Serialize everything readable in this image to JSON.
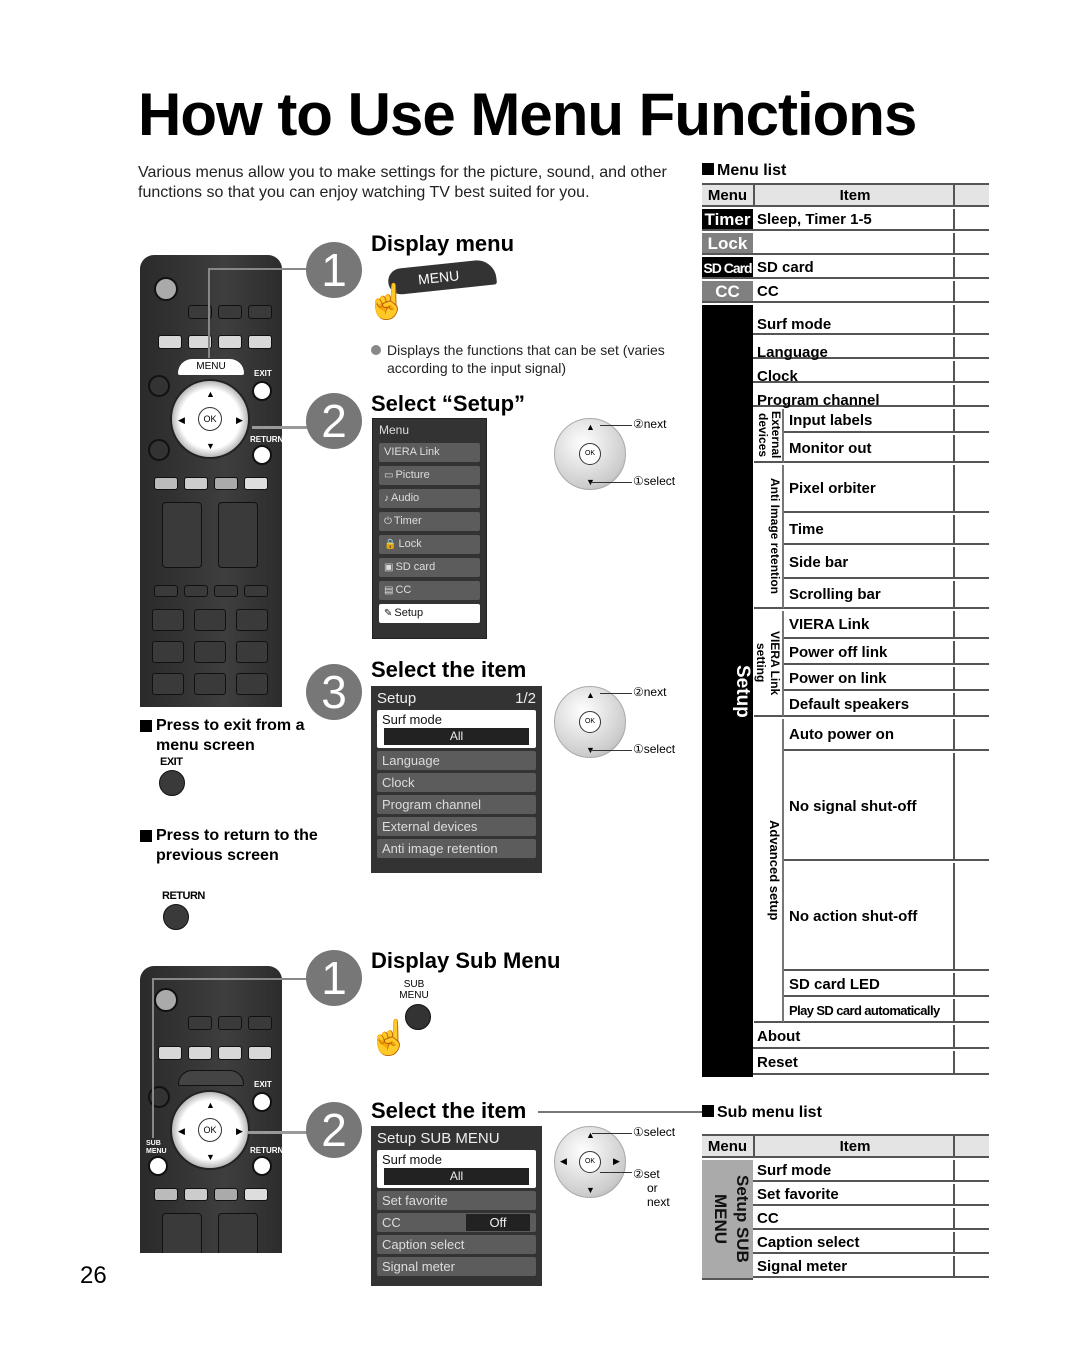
{
  "page": {
    "title": "How to Use Menu Functions",
    "intro": "Various menus allow you to make settings for the picture, sound, and other functions so that you can enjoy watching TV best suited for you.",
    "page_number": "26"
  },
  "remote": {
    "menu_label": "MENU",
    "exit_label": "EXIT",
    "return_label": "RETURN",
    "ok_label": "OK",
    "sub_menu_label": "SUB\nMENU"
  },
  "section1": {
    "steps": [
      {
        "number": "1",
        "heading": "Display menu",
        "button_label": "MENU",
        "note": "Displays the functions that can be set (varies according to the input signal)"
      },
      {
        "number": "2",
        "heading": "Select “Setup”"
      },
      {
        "number": "3",
        "heading": "Select the item"
      }
    ],
    "menu_osd": {
      "title": "Menu",
      "items": [
        {
          "icon": "",
          "label": "VIERA Link"
        },
        {
          "icon": "picture-icon",
          "label": "Picture"
        },
        {
          "icon": "audio-icon",
          "label": "Audio"
        },
        {
          "icon": "timer-icon",
          "label": "Timer"
        },
        {
          "icon": "lock-icon",
          "label": "Lock"
        },
        {
          "icon": "sd-card-icon",
          "label": "SD card"
        },
        {
          "icon": "cc-icon",
          "label": "CC"
        },
        {
          "icon": "setup-icon",
          "label": "Setup",
          "selected": true
        }
      ]
    },
    "setup_osd": {
      "title": "Setup",
      "page": "1/2",
      "selected_item": "Surf mode",
      "selected_value": "All",
      "items": [
        "Language",
        "Clock",
        "Program channel",
        "External devices",
        "Anti image retention"
      ]
    },
    "wheel_notes": {
      "next": "②next",
      "select": "①select"
    }
  },
  "side_notes": {
    "exit_heading": "Press to exit from a menu screen",
    "exit_button": "EXIT",
    "return_heading": "Press to return to the previous screen",
    "return_button": "RETURN"
  },
  "section2": {
    "steps": [
      {
        "number": "1",
        "heading": "Display Sub Menu",
        "button_label": "SUB MENU"
      },
      {
        "number": "2",
        "heading": "Select the item"
      }
    ],
    "sub_osd": {
      "title": "Setup SUB MENU",
      "selected_item": "Surf mode",
      "selected_value": "All",
      "items": [
        {
          "label": "Set favorite"
        },
        {
          "label": "CC",
          "value": "Off"
        },
        {
          "label": "Caption select"
        },
        {
          "label": "Signal meter"
        }
      ]
    },
    "wheel_notes": {
      "select": "①select",
      "set": "②set",
      "or": "or",
      "next": "next"
    }
  },
  "menu_list": {
    "heading": "Menu list",
    "col_menu": "Menu",
    "col_item": "Item",
    "top_rows": [
      {
        "menu": "Timer",
        "item": "Sleep, Timer 1-5",
        "color": "#000000"
      },
      {
        "menu": "Lock",
        "item": "",
        "color": "#808080"
      },
      {
        "menu": "SD Card",
        "item": "SD card",
        "color": "#000000"
      },
      {
        "menu": "CC",
        "item": "CC",
        "color": "#808080"
      }
    ],
    "setup_label": "Setup",
    "setup_items": [
      "Surf mode",
      "Language",
      "Clock",
      "Program channel"
    ],
    "groups": [
      {
        "label": "External devices",
        "items": [
          "Input labels",
          "Monitor out"
        ]
      },
      {
        "label": "Anti Image retention",
        "items": [
          "Pixel orbiter",
          "Time",
          "Side bar",
          "Scrolling bar"
        ]
      },
      {
        "label": "VIERA Link setting",
        "items": [
          "VIERA Link",
          "Power off link",
          "Power on link",
          "Default speakers"
        ]
      },
      {
        "label": "Advanced setup",
        "items": [
          "Auto power on",
          "No signal shut-off",
          "No action shut-off",
          "SD card LED",
          "Play SD card automatically"
        ]
      }
    ],
    "tail_items": [
      "About",
      "Reset"
    ]
  },
  "sub_menu_list": {
    "heading": "Sub menu list",
    "col_menu": "Menu",
    "col_item": "Item",
    "menu_label": "Setup SUB MENU",
    "items": [
      "Surf mode",
      "Set favorite",
      "CC",
      "Caption select",
      "Signal meter"
    ]
  }
}
